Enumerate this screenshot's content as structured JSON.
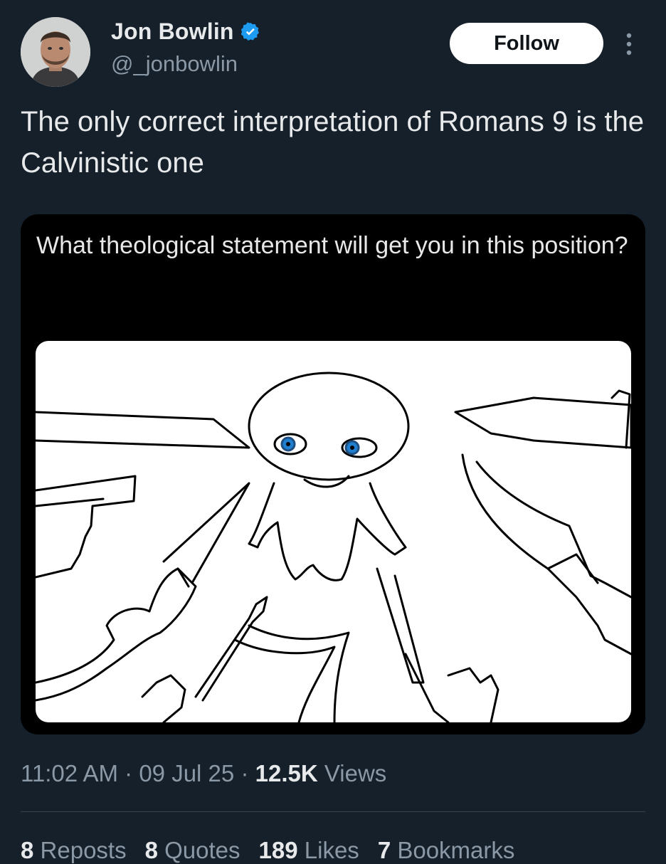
{
  "author": {
    "name": "Jon Bowlin",
    "handle": "@_jonbowlin",
    "verified": true
  },
  "actions": {
    "follow_label": "Follow",
    "more_icon": "more-vertical-icon"
  },
  "tweet": {
    "text": "The only correct interpretation of Romans 9 is the Calvinistic one"
  },
  "media": {
    "caption": "What theological statement will get you in this position?"
  },
  "meta": {
    "time": "11:02 AM",
    "sep1": "·",
    "date": "09 Jul 25",
    "sep2": "·",
    "views_count": "12.5K",
    "views_label": "Views"
  },
  "stats": [
    {
      "count": "8",
      "label": "Reposts"
    },
    {
      "count": "8",
      "label": "Quotes"
    },
    {
      "count": "189",
      "label": "Likes"
    },
    {
      "count": "7",
      "label": "Bookmarks"
    }
  ],
  "colors": {
    "background": "#15202b",
    "verified": "#1d9bf0",
    "muted": "#8b98a5"
  }
}
